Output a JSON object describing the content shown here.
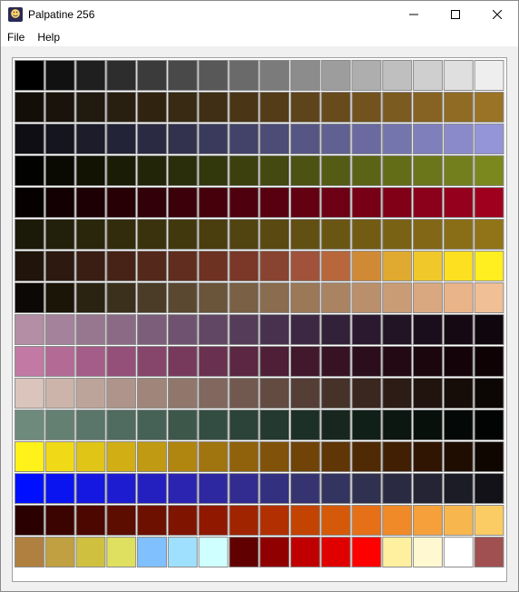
{
  "window": {
    "title": "Palpatine 256",
    "icon": "palpatine-app-icon",
    "controls": [
      "minimize-icon",
      "maximize-icon",
      "close-icon"
    ]
  },
  "menu": {
    "file_label": "File",
    "help_label": "Help"
  },
  "palette": {
    "columns": 16,
    "rows": 16,
    "colors": [
      [
        "#000000",
        "#111111",
        "#1f1f1f",
        "#2d2d2d",
        "#3b3b3b",
        "#494949",
        "#585858",
        "#6a6a6a",
        "#7b7b7b",
        "#8c8c8c",
        "#9d9d9d",
        "#aeaeae",
        "#bfbfbf",
        "#cfcfcf",
        "#dfdfdf",
        "#eeeeee"
      ],
      [
        "#130f08",
        "#1a130b",
        "#211a0e",
        "#281f10",
        "#302411",
        "#382a13",
        "#402f14",
        "#4a3516",
        "#543c18",
        "#5e441a",
        "#684b1c",
        "#72531e",
        "#7c5b20",
        "#866322",
        "#906b24",
        "#9a7326"
      ],
      [
        "#0e0e14",
        "#151520",
        "#1c1c2b",
        "#232337",
        "#2a2a43",
        "#32324f",
        "#3a3a5c",
        "#434369",
        "#4c4c76",
        "#565684",
        "#606092",
        "#6a6aa0",
        "#7575ae",
        "#7f7fbc",
        "#8a8aca",
        "#9494d8"
      ],
      [
        "#020200",
        "#0a0a02",
        "#131304",
        "#1b1c06",
        "#232508",
        "#2b2e0a",
        "#33370c",
        "#3b400e",
        "#434910",
        "#4b5212",
        "#535b14",
        "#5b6416",
        "#636d18",
        "#6b761a",
        "#737f1c",
        "#7b881e"
      ],
      [
        "#060000",
        "#120002",
        "#1d0004",
        "#270006",
        "#310008",
        "#3b000a",
        "#45000c",
        "#4f000e",
        "#590010",
        "#630012",
        "#6d0014",
        "#770016",
        "#810018",
        "#8b001a",
        "#95001c",
        "#9f001e"
      ],
      [
        "#1b1a08",
        "#22200a",
        "#2a260b",
        "#322c0c",
        "#3a320d",
        "#42380e",
        "#4a3e0f",
        "#524410",
        "#5a4a11",
        "#625012",
        "#6a5613",
        "#725c14",
        "#7a6215",
        "#826816",
        "#8a6e17",
        "#927418"
      ],
      [
        "#21140a",
        "#2d190f",
        "#3a1e13",
        "#472317",
        "#54281b",
        "#612d1f",
        "#6e3223",
        "#7b3727",
        "#884430",
        "#a0533a",
        "#b8673c",
        "#d08a36",
        "#e0aa30",
        "#f0c82a",
        "#fde01f",
        "#ffee20"
      ],
      [
        "#0b0805",
        "#1a1507",
        "#2a2312",
        "#3a301c",
        "#4a3c26",
        "#5a4830",
        "#6a543a",
        "#7a6044",
        "#8a6c4e",
        "#9a7858",
        "#aa8462",
        "#ba906c",
        "#ca9c76",
        "#daa880",
        "#eab48a",
        "#f0bf95"
      ],
      [
        "#b38ea5",
        "#a5829b",
        "#977690",
        "#8a6a85",
        "#7c5e7a",
        "#6f526f",
        "#624764",
        "#553c59",
        "#48314e",
        "#3d2843",
        "#332039",
        "#2a192f",
        "#221325",
        "#1b0e1c",
        "#150a14",
        "#10060d"
      ],
      [
        "#c27aa5",
        "#b36b96",
        "#a45c88",
        "#955079",
        "#86456b",
        "#773a5d",
        "#69304f",
        "#5b2743",
        "#4e1f37",
        "#42182d",
        "#361223",
        "#2c0d1b",
        "#230914",
        "#1b060e",
        "#140409",
        "#0e0205"
      ],
      [
        "#dbc4bb",
        "#ccb4aa",
        "#bda49a",
        "#ae948a",
        "#9f857a",
        "#90766b",
        "#81675d",
        "#72594f",
        "#634b42",
        "#553e36",
        "#47322a",
        "#3a271f",
        "#2d1c16",
        "#21130e",
        "#160c08",
        "#0c0604"
      ],
      [
        "#6e8a7d",
        "#648073",
        "#5a7569",
        "#506b5f",
        "#466155",
        "#3d574b",
        "#344d42",
        "#2c4339",
        "#243930",
        "#1d3028",
        "#172720",
        "#111f19",
        "#0c1712",
        "#08100c",
        "#040907",
        "#010402"
      ],
      [
        "#fff21a",
        "#f0da18",
        "#e0c416",
        "#d0ae14",
        "#c09a12",
        "#b08610",
        "#a0740e",
        "#90620c",
        "#80520a",
        "#704408",
        "#603606",
        "#502a04",
        "#401f03",
        "#301502",
        "#200d01",
        "#100600"
      ],
      [
        "#0010ff",
        "#0a14f0",
        "#1418e0",
        "#1e1cd0",
        "#2420c0",
        "#2a24b0",
        "#2e28a0",
        "#322c90",
        "#343080",
        "#363470",
        "#343460",
        "#303050",
        "#2a2a42",
        "#242434",
        "#1c1c26",
        "#121218"
      ],
      [
        "#2a0000",
        "#3b0400",
        "#4c0800",
        "#5d0c00",
        "#6e1000",
        "#7f1400",
        "#901800",
        "#a12400",
        "#b23000",
        "#c34400",
        "#d45a0a",
        "#e57018",
        "#f08a28",
        "#f5a03a",
        "#f8b64e",
        "#fbcc64"
      ],
      [
        "#b08040",
        "#c0a040",
        "#d0c040",
        "#e0e060",
        "#80c0ff",
        "#a0e0ff",
        "#d0ffff",
        "#600000",
        "#900000",
        "#c00000",
        "#e00000",
        "#ff0000",
        "#fff0a0",
        "#fff8d0",
        "#ffffff",
        "#a05050"
      ]
    ]
  }
}
